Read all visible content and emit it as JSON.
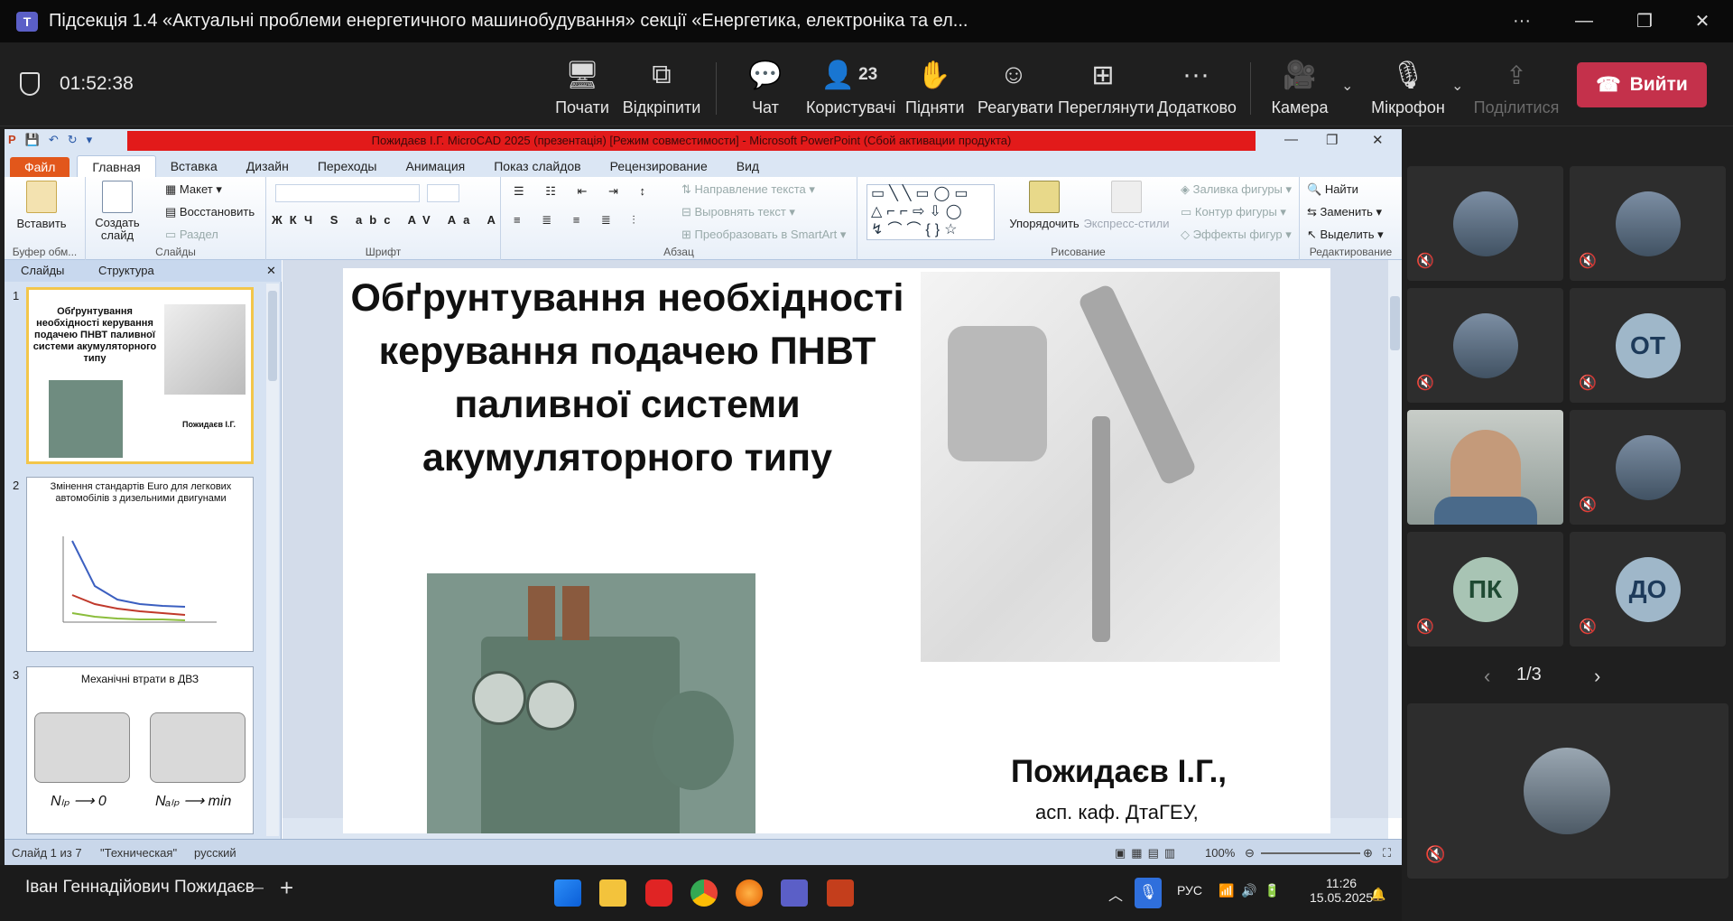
{
  "window": {
    "title": "Підсекція 1.4 «Актуальні проблеми енергетичного машинобудування» секції «Енергетика, електроніка та ел...",
    "more": "···",
    "minimize": "—",
    "maximize": "❐",
    "close": "✕"
  },
  "meeting": {
    "timer": "01:52:38",
    "buttons": {
      "start": "Почати",
      "unpin": "Відкріпити",
      "chat": "Чат",
      "users_count": "23",
      "users": "Користувачі",
      "raise": "Підняти",
      "react": "Реагувати",
      "view": "Переглянути",
      "more": "Додатково",
      "camera": "Камера",
      "mic": "Мікрофон",
      "share": "Поділитися",
      "leave": "Вийти"
    }
  },
  "powerpoint": {
    "title": "Пожидаєв І.Г. MicroCAD 2025 (презентація) [Режим совместимости] - Microsoft PowerPoint (Сбой активации продукта)",
    "tabs": [
      "Файл",
      "Главная",
      "Вставка",
      "Дизайн",
      "Переходы",
      "Анимация",
      "Показ слайдов",
      "Рецензирование",
      "Вид"
    ],
    "ribbon": {
      "paste": "Вставить",
      "clipboard_group": "Буфер обм...",
      "new_slide": "Создать слайд",
      "layout": "Макет",
      "reset": "Восстановить",
      "section": "Раздел",
      "slides_group": "Слайды",
      "font_group": "Шрифт",
      "text_dir": "Направление текста",
      "align_text": "Выровнять текст",
      "smartart": "Преобразовать в SmartArt",
      "paragraph_group": "Абзац",
      "arrange": "Упорядочить",
      "quick_styles": "Экспресс-стили",
      "fill": "Заливка фигуры",
      "outline": "Контур фигуры",
      "effects": "Эффекты фигур",
      "drawing_group": "Рисование",
      "find": "Найти",
      "replace": "Заменить",
      "select": "Выделить",
      "editing_group": "Редактирование"
    },
    "panel": {
      "tab_slides": "Слайды",
      "tab_outline": "Структура",
      "thumbs": [
        {
          "num": "1",
          "title": "Обґрунтування необхідності керування подачею ПНВТ паливної системи акумуляторного типу",
          "author": "Пожидаєв І.Г."
        },
        {
          "num": "2",
          "title": "Змінення стандартів Euro для легкових автомобілів з дизельними двигунами"
        },
        {
          "num": "3",
          "title": "Механічні втрати в ДВЗ",
          "left_formula": "Nₗₚ ⟶ 0",
          "right_formula": "Nₐₗₚ ⟶ min"
        }
      ]
    },
    "slide": {
      "title": "Обґрунтування необхідності керування подачею ПНВТ паливної системи акумуляторного типу",
      "author": "Пожидаєв І.Г.,",
      "affiliation": "асп. каф. ДтаГЕУ,"
    },
    "status": {
      "slide_of": "Слайд 1 из 7",
      "theme": "\"Техническая\"",
      "lang": "русский",
      "zoom": "100%"
    }
  },
  "taskbar": {
    "presenter": "Іван Геннадійович Пожидаєв",
    "lang": "РУС",
    "time": "11:26",
    "date": "15.05.2025"
  },
  "participants": {
    "tiles": [
      {
        "initials": "",
        "kind": "photo"
      },
      {
        "initials": "",
        "kind": "photo"
      },
      {
        "initials": "",
        "kind": "photo"
      },
      {
        "initials": "ОТ",
        "kind": "initials"
      },
      {
        "initials": "",
        "kind": "video"
      },
      {
        "initials": "",
        "kind": "photo"
      },
      {
        "initials": "ПК",
        "kind": "initials"
      },
      {
        "initials": "ДО",
        "kind": "initials"
      }
    ],
    "page": "1/3"
  },
  "colors": {
    "leave": "#c4314b",
    "teams_purple": "#5b5fc7",
    "ppt_file_tab": "#e2571b"
  }
}
